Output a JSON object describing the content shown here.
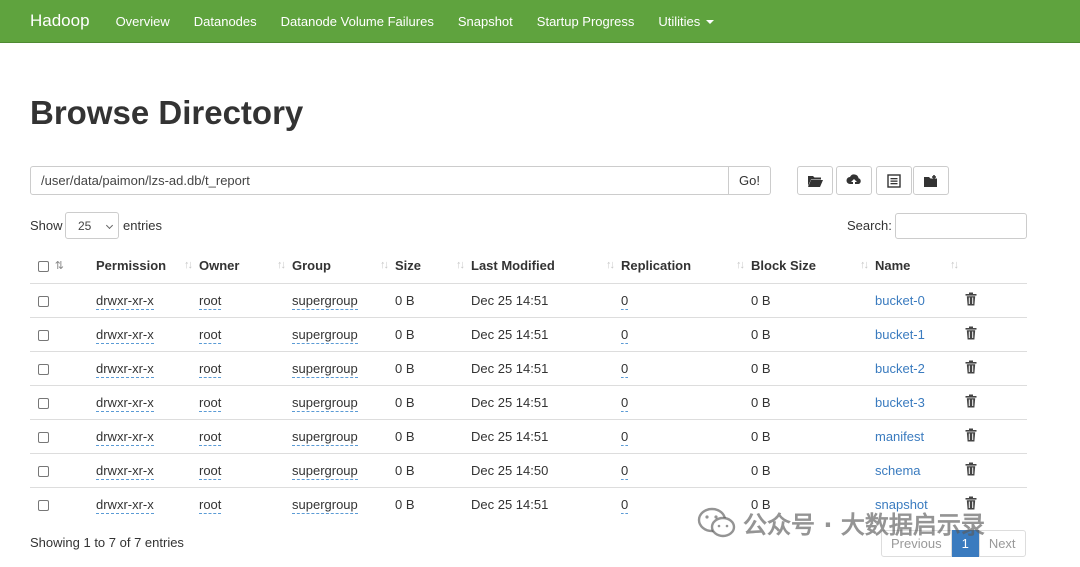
{
  "navbar": {
    "brand": "Hadoop",
    "items": [
      "Overview",
      "Datanodes",
      "Datanode Volume Failures",
      "Snapshot",
      "Startup Progress",
      "Utilities"
    ]
  },
  "page_title": "Browse Directory",
  "path": {
    "value": "/user/data/paimon/lzs-ad.db/t_report",
    "go_label": "Go!"
  },
  "toolbar_icons": [
    "folder-open-icon",
    "cloud-upload-icon",
    "list-alt-icon",
    "folder-plus-icon"
  ],
  "entries": {
    "show": "Show",
    "value": "25",
    "suffix": "entries",
    "search_label": "Search:"
  },
  "table": {
    "headers": [
      "Permission",
      "Owner",
      "Group",
      "Size",
      "Last Modified",
      "Replication",
      "Block Size",
      "Name"
    ],
    "rows": [
      {
        "permission": "drwxr-xr-x",
        "owner": "root",
        "group": "supergroup",
        "size": "0 B",
        "modified": "Dec 25 14:51",
        "replication": "0",
        "block": "0 B",
        "name": "bucket-0"
      },
      {
        "permission": "drwxr-xr-x",
        "owner": "root",
        "group": "supergroup",
        "size": "0 B",
        "modified": "Dec 25 14:51",
        "replication": "0",
        "block": "0 B",
        "name": "bucket-1"
      },
      {
        "permission": "drwxr-xr-x",
        "owner": "root",
        "group": "supergroup",
        "size": "0 B",
        "modified": "Dec 25 14:51",
        "replication": "0",
        "block": "0 B",
        "name": "bucket-2"
      },
      {
        "permission": "drwxr-xr-x",
        "owner": "root",
        "group": "supergroup",
        "size": "0 B",
        "modified": "Dec 25 14:51",
        "replication": "0",
        "block": "0 B",
        "name": "bucket-3"
      },
      {
        "permission": "drwxr-xr-x",
        "owner": "root",
        "group": "supergroup",
        "size": "0 B",
        "modified": "Dec 25 14:51",
        "replication": "0",
        "block": "0 B",
        "name": "manifest"
      },
      {
        "permission": "drwxr-xr-x",
        "owner": "root",
        "group": "supergroup",
        "size": "0 B",
        "modified": "Dec 25 14:50",
        "replication": "0",
        "block": "0 B",
        "name": "schema"
      },
      {
        "permission": "drwxr-xr-x",
        "owner": "root",
        "group": "supergroup",
        "size": "0 B",
        "modified": "Dec 25 14:51",
        "replication": "0",
        "block": "0 B",
        "name": "snapshot"
      }
    ]
  },
  "footer": {
    "showing": "Showing 1 to 7 of 7 entries",
    "prev": "Previous",
    "page": "1",
    "next": "Next"
  },
  "watermark": "公众号 · 大数据启示录",
  "colors": {
    "navbar": "#5fa33e",
    "link": "#3a7bbf"
  }
}
